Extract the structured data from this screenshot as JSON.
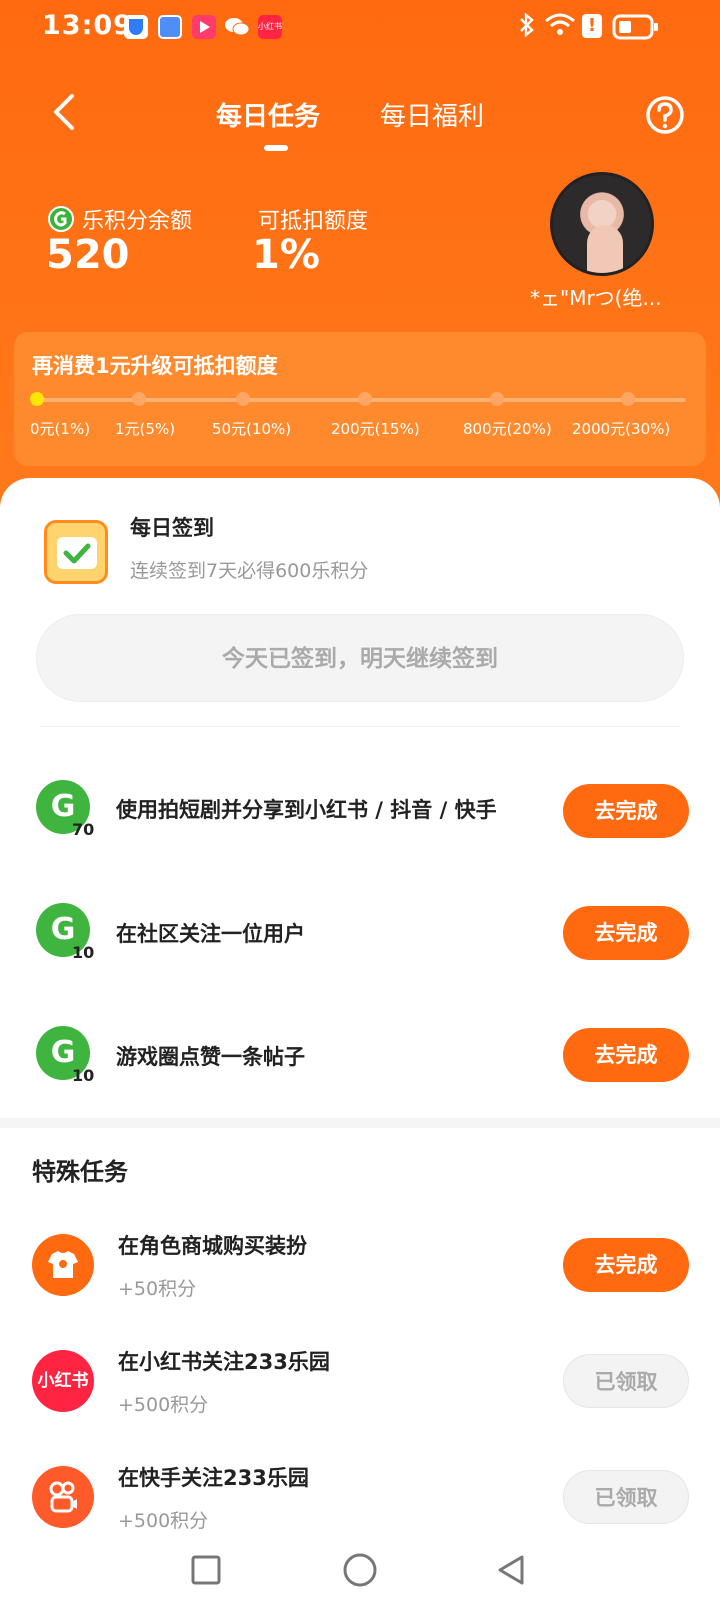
{
  "status": {
    "time": "13:09",
    "battery_icon": "battery-icon",
    "app_badge": "小红书"
  },
  "nav": {
    "tabs": [
      {
        "label": "每日任务",
        "active": true
      },
      {
        "label": "每日福利",
        "active": false
      }
    ]
  },
  "balance": {
    "points_label": "乐积分余额",
    "points_value": "520",
    "deduction_label": "可抵扣额度",
    "deduction_value": "1%"
  },
  "user": {
    "name": "*ェ\"Mrつ(绝..."
  },
  "progress": {
    "title": "再消费1元升级可抵扣额度",
    "current_step": 0,
    "steps": [
      "0元(1%)",
      "1元(5%)",
      "50元(10%)",
      "200元(15%)",
      "800元(20%)",
      "2000元(30%)"
    ]
  },
  "checkin": {
    "title": "每日签到",
    "subtitle": "连续签到7天必得600乐积分",
    "button": "今天已签到，明天继续签到"
  },
  "daily_tasks": [
    {
      "points": "70",
      "text": "使用拍短剧并分享到小红书 / 抖音 / 快手",
      "button": "去完成"
    },
    {
      "points": "10",
      "text": "在社区关注一位用户",
      "button": "去完成"
    },
    {
      "points": "10",
      "text": "游戏圈点赞一条帖子",
      "button": "去完成"
    }
  ],
  "special": {
    "section_title": "特殊任务",
    "items": [
      {
        "title": "在角色商城购买装扮",
        "sub": "+50积分",
        "button": "去完成",
        "done": false,
        "icon": "shirt-icon"
      },
      {
        "title": "在小红书关注233乐园",
        "sub": "+500积分",
        "button": "已领取",
        "done": true,
        "icon": "xiaohongshu-icon",
        "icon_text": "小红书"
      },
      {
        "title": "在快手关注233乐园",
        "sub": "+500积分",
        "button": "已领取",
        "done": true,
        "icon": "kuaishou-icon"
      }
    ]
  },
  "colors": {
    "accent": "#ff6a10",
    "coin_green": "#3fb53f"
  }
}
